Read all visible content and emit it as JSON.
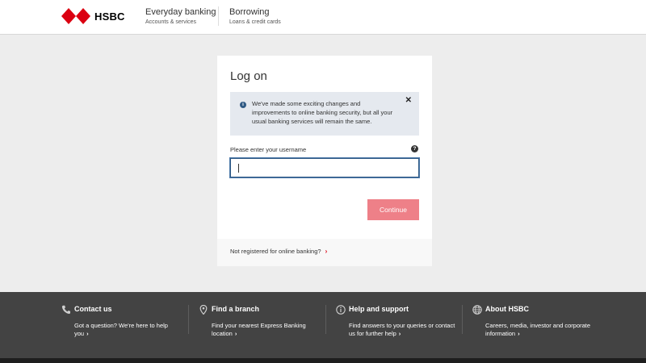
{
  "header": {
    "logo_text": "HSBC",
    "brand_color": "#db0011",
    "nav": [
      {
        "title": "Everyday banking",
        "subtitle": "Accounts & services"
      },
      {
        "title": "Borrowing",
        "subtitle": "Loans & credit cards"
      }
    ]
  },
  "login": {
    "title": "Log on",
    "notice": "We've made some exciting changes and improvements to online banking security, but all your usual banking services will remain the same.",
    "close_glyph": "✕",
    "info_glyph": "i",
    "username_label": "Please enter your username",
    "help_glyph": "?",
    "username_value": "",
    "continue_label": "Continue",
    "register_link": "Not registered for online banking?",
    "button_color": "#ee8088"
  },
  "footer": {
    "columns": [
      {
        "icon": "phone-icon",
        "title": "Contact us",
        "desc": "Got a question? We're here to help you"
      },
      {
        "icon": "map-pin-icon",
        "title": "Find a branch",
        "desc": "Find your nearest Express Banking location"
      },
      {
        "icon": "info-circle-icon",
        "title": "Help and support",
        "desc": "Find answers to your queries or contact us for further help"
      },
      {
        "icon": "globe-icon",
        "title": "About HSBC",
        "desc": "Careers, media, investor and corporate information"
      }
    ],
    "chevron": "›"
  }
}
